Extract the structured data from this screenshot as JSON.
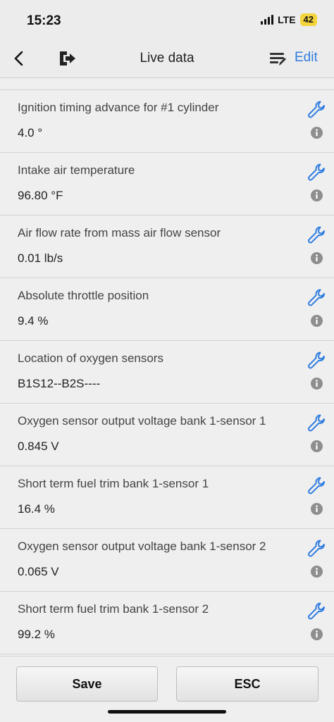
{
  "status_bar": {
    "time": "15:23",
    "network": "LTE",
    "battery": "42"
  },
  "nav": {
    "title": "Live data",
    "edit_label": "Edit",
    "accent_color": "#2f7de0"
  },
  "rows": [
    {
      "label": "Ignition timing advance for #1 cylinder",
      "value": "4.0 °"
    },
    {
      "label": "Intake air temperature",
      "value": "96.80 °F"
    },
    {
      "label": "Air flow rate from mass air flow sensor",
      "value": "0.01 lb/s"
    },
    {
      "label": "Absolute throttle position",
      "value": "9.4 %"
    },
    {
      "label": "Location of oxygen sensors",
      "value": "B1S12--B2S----"
    },
    {
      "label": "Oxygen sensor output voltage bank 1-sensor 1",
      "value": "0.845 V"
    },
    {
      "label": "Short term fuel trim bank 1-sensor 1",
      "value": "16.4 %"
    },
    {
      "label": "Oxygen sensor output voltage bank 1-sensor 2",
      "value": "0.065 V"
    },
    {
      "label": "Short term fuel trim bank 1-sensor 2",
      "value": "99.2 %"
    }
  ],
  "footer": {
    "save_label": "Save",
    "esc_label": "ESC"
  }
}
